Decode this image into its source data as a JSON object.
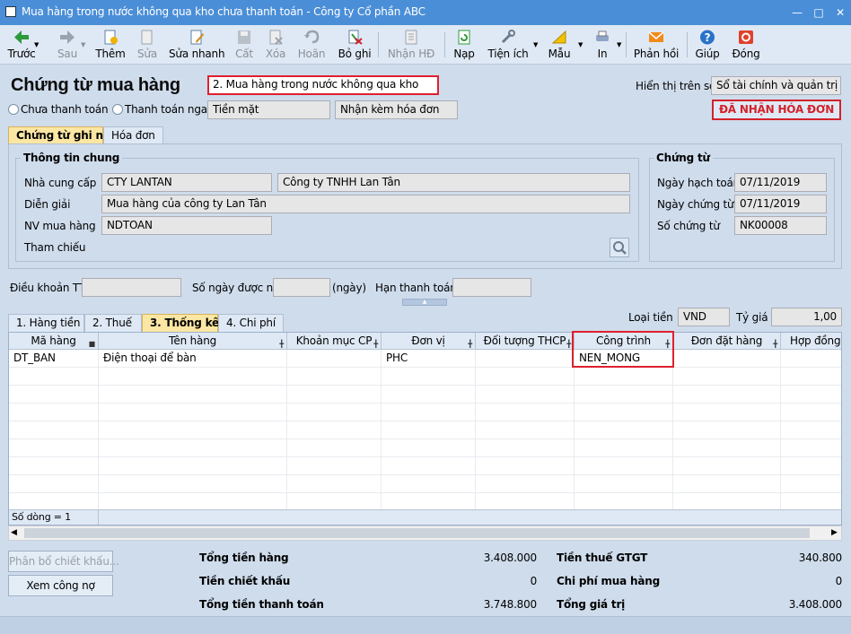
{
  "window": {
    "title": "Mua hàng trong nước không qua kho chưa thanh toán - Công ty Cổ phần ABC"
  },
  "toolbar": {
    "items": [
      {
        "label": "Trước",
        "icon": "arrow-left-icon"
      },
      {
        "label": "Sau",
        "icon": "arrow-right-icon"
      },
      {
        "label": "Thêm",
        "icon": "add-doc-icon"
      },
      {
        "label": "Sửa",
        "icon": "edit-icon"
      },
      {
        "label": "Sửa nhanh",
        "icon": "quick-edit-icon"
      },
      {
        "label": "Cất",
        "icon": "save-icon"
      },
      {
        "label": "Xóa",
        "icon": "delete-icon"
      },
      {
        "label": "Hoãn",
        "icon": "undo-icon"
      },
      {
        "label": "Bỏ ghi",
        "icon": "unpost-icon"
      },
      {
        "label": "Nhận HĐ",
        "icon": "invoice-icon"
      },
      {
        "label": "Nạp",
        "icon": "reload-icon"
      },
      {
        "label": "Tiện ích",
        "icon": "tools-icon"
      },
      {
        "label": "Mẫu",
        "icon": "template-icon"
      },
      {
        "label": "In",
        "icon": "print-icon"
      },
      {
        "label": "Phản hồi",
        "icon": "feedback-icon"
      },
      {
        "label": "Giúp",
        "icon": "help-icon"
      },
      {
        "label": "Đóng",
        "icon": "close-icon"
      }
    ]
  },
  "header": {
    "title": "Chứng từ mua hàng",
    "type_value": "2. Mua hàng trong nước không qua kho",
    "display_label": "Hiển thị trên sổ",
    "display_value": "Sổ tài chính và quản trị",
    "radio_unpaid": "Chưa thanh toán",
    "radio_paid": "Thanh toán ngay",
    "payment_method": "Tiền mặt",
    "invoice_option": "Nhận kèm hóa đơn",
    "status_badge": "ĐÃ NHẬN HÓA ĐƠN"
  },
  "doc_tabs": [
    "Chứng từ ghi nợ",
    "Hóa đơn"
  ],
  "general": {
    "group_title": "Thông tin chung",
    "supplier_label": "Nhà cung cấp",
    "supplier_code": "CTY LANTAN",
    "supplier_name": "Công ty TNHH Lan Tân",
    "desc_label": "Diễn giải",
    "desc_value": "Mua hàng của công ty Lan Tân",
    "buyer_label": "NV mua hàng",
    "buyer_value": "NDTOAN",
    "ref_label": "Tham chiếu"
  },
  "voucher": {
    "group_title": "Chứng từ",
    "post_date_label": "Ngày hạch toán",
    "post_date": "07/11/2019",
    "doc_date_label": "Ngày chứng từ",
    "doc_date": "07/11/2019",
    "doc_no_label": "Số chứng từ",
    "doc_no": "NK00008"
  },
  "terms": {
    "terms_label": "Điều khoản TT",
    "days_label": "Số ngày được nợ",
    "days_unit": "(ngày)",
    "due_label": "Hạn thanh toán"
  },
  "currency": {
    "label": "Loại tiền",
    "value": "VND",
    "rate_label": "Tỷ giá",
    "rate_value": "1,00"
  },
  "detail_tabs": [
    "1. Hàng tiền",
    "2. Thuế",
    "3. Thống kê",
    "4. Chi phí"
  ],
  "grid": {
    "columns": [
      "Mã hàng",
      "Tên hàng",
      "Khoản mục CP",
      "Đơn vị",
      "Đối tượng THCP",
      "Công trình",
      "Đơn đặt hàng",
      "Hợp đồng m"
    ],
    "rows": [
      {
        "ma_hang": "DT_BAN",
        "ten_hang": "Điện thoại để bàn",
        "khoan_muc": "",
        "don_vi": "PHC",
        "doi_tuong": "",
        "cong_trinh": "NEN_MONG",
        "don_dat_hang": "",
        "hop_dong": ""
      }
    ],
    "row_count": "Số dòng = 1"
  },
  "buttons": {
    "allocate": "Phân bổ chiết khấu...",
    "view_debt": "Xem công nợ"
  },
  "totals": {
    "goods_label": "Tổng tiền hàng",
    "goods": "3.408.000",
    "discount_label": "Tiền chiết khấu",
    "discount": "0",
    "payment_label": "Tổng tiền thanh toán",
    "payment": "3.748.800",
    "vat_label": "Tiền thuế GTGT",
    "vat": "340.800",
    "cost_label": "Chi phí mua hàng",
    "cost": "0",
    "value_label": "Tổng giá trị",
    "value": "3.408.000"
  }
}
